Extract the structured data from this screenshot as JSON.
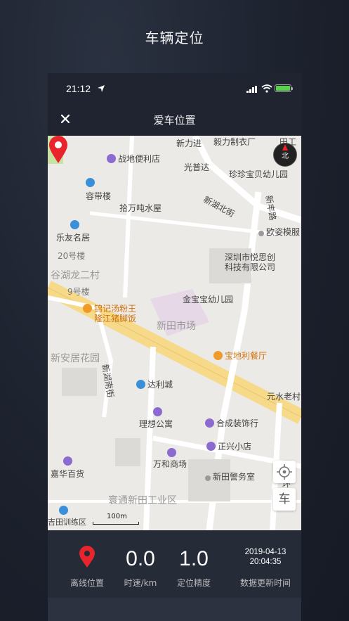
{
  "promo": {
    "title": "车辆定位"
  },
  "status_bar": {
    "time": "21:12"
  },
  "nav": {
    "title": "爱车位置"
  },
  "map": {
    "labels": [
      {
        "text": "新力进",
        "style": "plain"
      },
      {
        "text": "毅力制衣厂",
        "style": "plain"
      },
      {
        "text": "田工",
        "style": "plain"
      },
      {
        "text": "战地便利店",
        "style": "blue"
      },
      {
        "text": "光普达",
        "style": "plain"
      },
      {
        "text": "珍珍宝贝幼儿园",
        "style": "plain"
      },
      {
        "text": "容带楼",
        "style": "blue"
      },
      {
        "text": "拾万吨水屋",
        "style": "plain"
      },
      {
        "text": "新湖北街",
        "style": "plain"
      },
      {
        "text": "新丰路",
        "style": "plain"
      },
      {
        "text": "乐友名居",
        "style": "blue"
      },
      {
        "text": "欧姿模服",
        "style": "plain"
      },
      {
        "text": "20号楼",
        "style": "gray"
      },
      {
        "text": "深圳市悦思创",
        "style": "plain"
      },
      {
        "text": "科技有限公司",
        "style": "plain"
      },
      {
        "text": "谷湖龙二村",
        "style": "big"
      },
      {
        "text": "9号楼",
        "style": "gray"
      },
      {
        "text": "金宝宝幼儿园",
        "style": "plain"
      },
      {
        "text": "锦记汤粉王",
        "style": "orange"
      },
      {
        "text": "隆江猪脚饭",
        "style": "orange"
      },
      {
        "text": "新田市场",
        "style": "big"
      },
      {
        "text": "新安居花园",
        "style": "big"
      },
      {
        "text": "宝地利餐厅",
        "style": "orange"
      },
      {
        "text": "新湖南街",
        "style": "plain"
      },
      {
        "text": "达利城",
        "style": "blue"
      },
      {
        "text": "元水老村",
        "style": "blue"
      },
      {
        "text": "理想公寓",
        "style": "blue"
      },
      {
        "text": "合成装饰行",
        "style": "plain"
      },
      {
        "text": "正兴小店",
        "style": "plain"
      },
      {
        "text": "万和商场",
        "style": "plain"
      },
      {
        "text": "嘉华百货",
        "style": "plain"
      },
      {
        "text": "新田警务室",
        "style": "plain"
      },
      {
        "text": "寰通新田工业区",
        "style": "big"
      },
      {
        "text": "吉田训练区",
        "style": "plain"
      },
      {
        "text": "环",
        "style": "plain"
      },
      {
        "text": "路",
        "style": "plain"
      }
    ],
    "compass": "北",
    "scale": "100m",
    "car_button": "车",
    "pin_color": "#e8242c"
  },
  "panel": {
    "offline_label": "离线位置",
    "speed_value": "0.0",
    "speed_label": "时速/km",
    "accuracy_value": "1.0",
    "accuracy_label": "定位精度",
    "update_date": "2019-04-13",
    "update_time": "20:04:35",
    "update_label": "数据更新时间"
  },
  "colors": {
    "accent": "#e8242c",
    "battery": "#59d24b",
    "background": "#1c2230"
  }
}
